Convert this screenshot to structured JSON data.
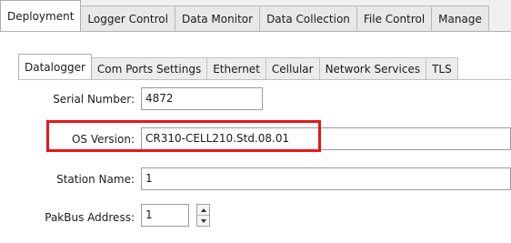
{
  "main_tabs": [
    "Deployment",
    "Logger Control",
    "Data Monitor",
    "Data Collection",
    "File Control",
    "Manage"
  ],
  "active_main_tab": "Deployment",
  "sub_tabs": [
    "Datalogger",
    "Com Ports Settings",
    "Ethernet",
    "Cellular",
    "Network Services",
    "TLS"
  ],
  "active_sub_tab": "Datalogger",
  "fields": {
    "serial_number": {
      "label": "Serial Number:",
      "value": "4872"
    },
    "os_version": {
      "label": "OS Version:",
      "value": "CR310-CELL210.Std.08.01"
    },
    "station_name": {
      "label": "Station Name:",
      "value": "1"
    },
    "pakbus_address": {
      "label": "PakBus Address:",
      "value": "1"
    }
  },
  "icons": {
    "spinner_up": "chevron-up-icon",
    "spinner_down": "chevron-down-icon"
  },
  "colors": {
    "highlight": "#e8151c",
    "panel": "#ffffff",
    "background": "#f0f0f0"
  }
}
